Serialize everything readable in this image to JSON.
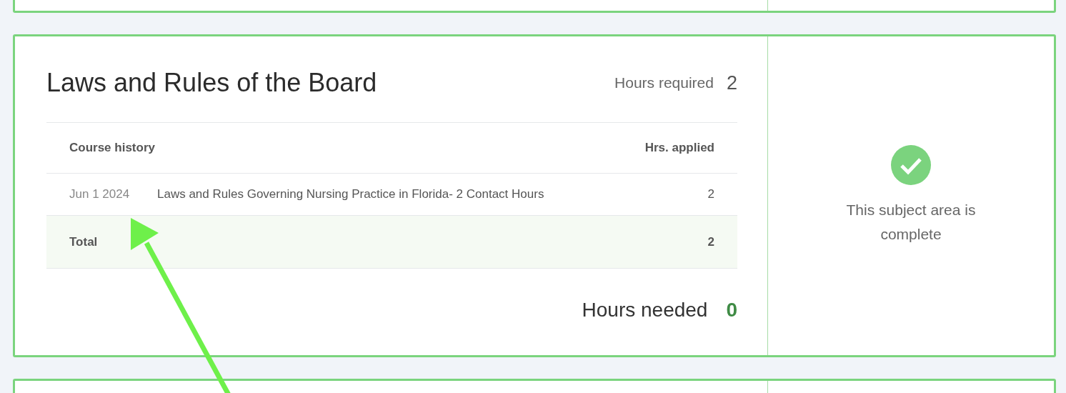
{
  "subject": {
    "title": "Laws and Rules of the Board",
    "hours_required_label": "Hours required",
    "hours_required": "2",
    "table": {
      "columns": [
        "Course history",
        "Hrs. applied"
      ],
      "rows": [
        {
          "date": "Jun 1 2024",
          "course": "Laws and Rules Governing Nursing Practice in Florida- 2 Contact Hours",
          "hours": "2"
        }
      ],
      "total": {
        "label": "Total",
        "hours": "2"
      }
    },
    "hours_needed_label": "Hours needed",
    "hours_needed": "0",
    "complete": true,
    "status_text": "This subject area is complete"
  },
  "annotation": {
    "kind": "arrow"
  }
}
